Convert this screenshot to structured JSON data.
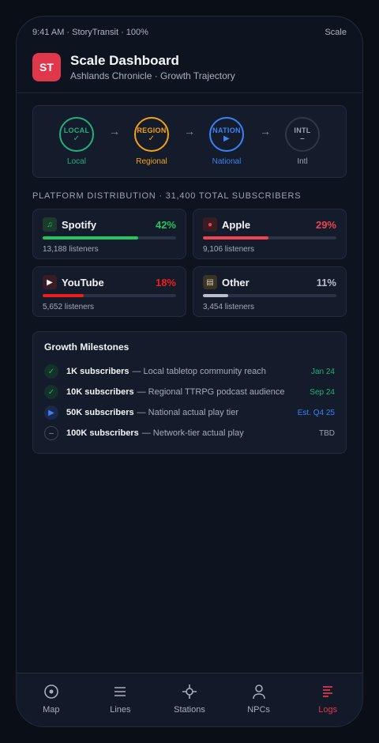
{
  "status_bar": {
    "left": "9:41 AM · StoryTransit · 100%",
    "right": "Scale"
  },
  "header": {
    "logo": "ST",
    "title": "Scale Dashboard",
    "subtitle": "Ashlands Chronicle · Growth Trajectory"
  },
  "stages": [
    {
      "code": "LOCAL",
      "glyph": "✓",
      "label": "Local",
      "color": "#22b07d"
    },
    {
      "code": "REGION",
      "glyph": "✓",
      "label": "Regional",
      "color": "#f0a21c"
    },
    {
      "code": "NATION",
      "glyph": "▶",
      "label": "National",
      "color": "#3b82f6"
    },
    {
      "code": "INTL",
      "glyph": "–",
      "label": "Intl",
      "color": "#9aa3b3"
    }
  ],
  "platform_section_label": "PLATFORM DISTRIBUTION · 31,400 TOTAL SUBSCRIBERS",
  "platforms": [
    {
      "name": "Spotify",
      "percent_text": "42%",
      "share": 0.42,
      "listeners": "13,188 listeners",
      "color": "#22c55e",
      "icon": "music-note-icon"
    },
    {
      "name": "Apple",
      "percent_text": "29%",
      "share": 0.29,
      "listeners": "9,106 listeners",
      "color": "#ef4450",
      "icon": "apple-icon"
    },
    {
      "name": "YouTube",
      "percent_text": "18%",
      "share": 0.18,
      "listeners": "5,652 listeners",
      "color": "#ef1c1c",
      "icon": "play-icon"
    },
    {
      "name": "Other",
      "percent_text": "11%",
      "share": 0.11,
      "listeners": "3,454 listeners",
      "color": "#b8bfcc",
      "icon": "radio-icon"
    }
  ],
  "milestones": {
    "title": "Growth Milestones",
    "items": [
      {
        "bold": "1K subscribers",
        "desc": "— Local tabletop community reach",
        "date": "Jan 24",
        "state": "done",
        "color": "#22b07d"
      },
      {
        "bold": "10K subscribers",
        "desc": "— Regional TTRPG podcast audience",
        "date": "Sep 24",
        "state": "done",
        "color": "#22b07d"
      },
      {
        "bold": "50K subscribers",
        "desc": "— National actual play tier",
        "date": "Est. Q4 25",
        "state": "active",
        "color": "#3b82f6"
      },
      {
        "bold": "100K subscribers",
        "desc": "— Network-tier actual play",
        "date": "TBD",
        "state": "pending",
        "color": "#9aa3b3"
      }
    ]
  },
  "nav": [
    {
      "label": "Map",
      "icon": "target-icon",
      "active": false
    },
    {
      "label": "Lines",
      "icon": "menu-lines-icon",
      "active": false
    },
    {
      "label": "Stations",
      "icon": "crosshair-icon",
      "active": false
    },
    {
      "label": "NPCs",
      "icon": "person-icon",
      "active": false
    },
    {
      "label": "Logs",
      "icon": "logs-icon",
      "active": true
    }
  ]
}
